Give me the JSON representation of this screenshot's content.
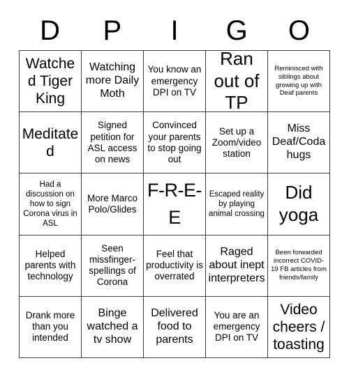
{
  "card": {
    "header_letters": [
      "D",
      "P",
      "I",
      "G",
      "O"
    ],
    "rows": 5,
    "columns": 5,
    "colors": {
      "background": "#ffffff",
      "text": "#000000",
      "grid_line": "#3a3a3a"
    },
    "cells": [
      {
        "text": "Watched Tiger King",
        "size": "xl"
      },
      {
        "text": "Watching more Daily Moth",
        "size": "l"
      },
      {
        "text": "You know an emergency DPI on TV",
        "size": "m"
      },
      {
        "text": "Ran out of TP",
        "size": "xxl"
      },
      {
        "text": "Reminisced with siblings about growing up with Deaf parents",
        "size": "xs"
      },
      {
        "text": "Meditated",
        "size": "xl"
      },
      {
        "text": "Signed petition for ASL access on news",
        "size": "m"
      },
      {
        "text": "Convinced your parents to stop going out",
        "size": "m"
      },
      {
        "text": "Set up a Zoom/video station",
        "size": "m"
      },
      {
        "text": "Miss Deaf/Coda hugs",
        "size": "l"
      },
      {
        "text": "Had a discussion on how to sign Corona virus in ASL",
        "size": "s"
      },
      {
        "text": "More Marco Polo/Glides",
        "size": "m"
      },
      {
        "text": "F-R-E-E",
        "size": "free"
      },
      {
        "text": "Escaped reality by playing animal crossing",
        "size": "s"
      },
      {
        "text": "Did yoga",
        "size": "xxl"
      },
      {
        "text": "Helped parents with technology",
        "size": "m"
      },
      {
        "text": "Seen missfinger-spellings of Corona",
        "size": "m"
      },
      {
        "text": "Feel that productivity is overrated",
        "size": "m"
      },
      {
        "text": "Raged about inept interpreters",
        "size": "l"
      },
      {
        "text": "Been forwarded incorrect COVID-19 FB articles from friends/family",
        "size": "xs"
      },
      {
        "text": "Drank more than you intended",
        "size": "m"
      },
      {
        "text": "Binge watched a tv show",
        "size": "l"
      },
      {
        "text": "Delivered food to parents",
        "size": "l"
      },
      {
        "text": "You are an emergency DPI on TV",
        "size": "m"
      },
      {
        "text": "Video cheers / toasting",
        "size": "xl"
      }
    ]
  }
}
